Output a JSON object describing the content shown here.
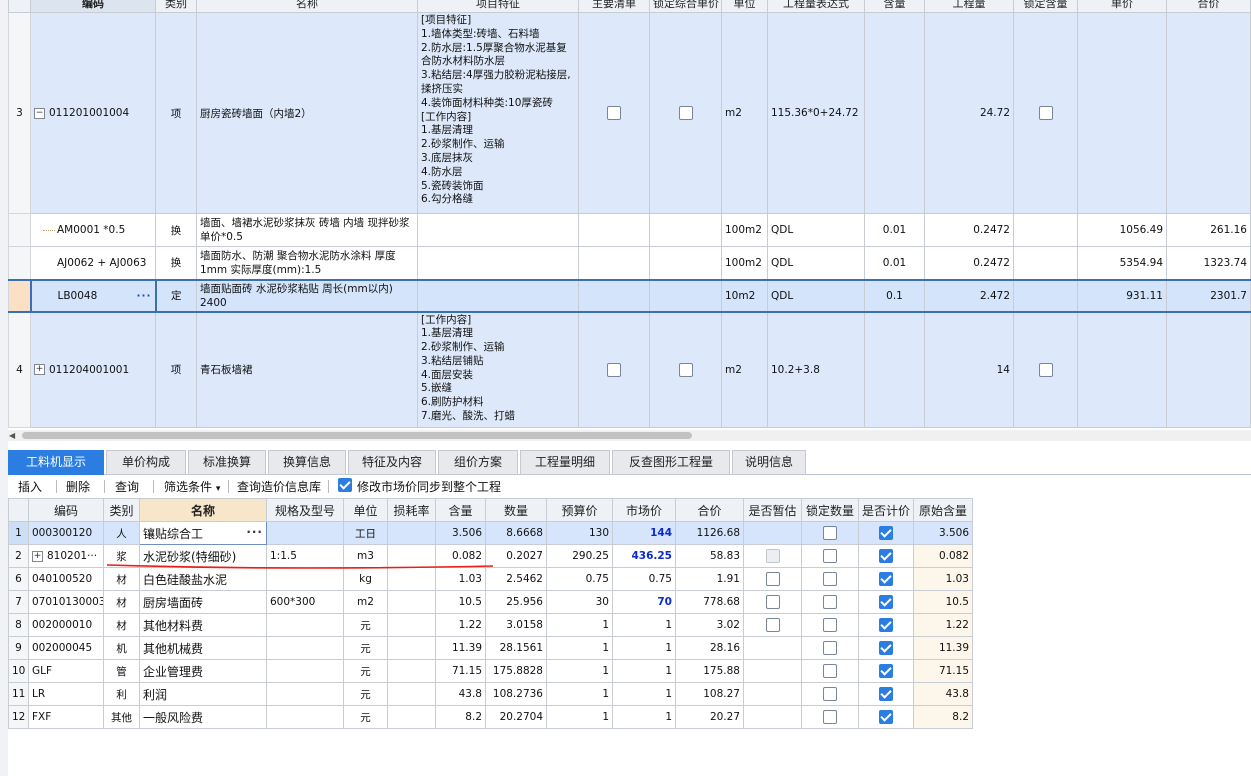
{
  "upper": {
    "headers": [
      "编码",
      "类别",
      "名称",
      "项目特征",
      "主要清单",
      "锁定综合单价",
      "单位",
      "工程量表达式",
      "含量",
      "工程量",
      "锁定含量",
      "单价",
      "合价"
    ],
    "rows": [
      {
        "rownum": "3",
        "code": "011201001004",
        "expander": "−",
        "type": "项",
        "name": "厨房瓷砖墙面（内墙2）",
        "feature": "[项目特征]\n1.墙体类型:砖墙、石料墙\n2.防水层:1.5厚聚合物水泥基复合防水材料防水层\n3.粘结层:4厚强力胶粉泥粘接层,揉挤压实\n4.装饰面材料种类:10厚瓷砖\n[工作内容]\n1.基层清理\n2.砂浆制作、运输\n3.底层抹灰\n4.防水层\n5.瓷砖装饰面\n6.勾分格缝",
        "unit": "m2",
        "expr": "115.36*0+24.72",
        "content": "",
        "qty": "24.72",
        "price": "",
        "total": ""
      },
      {
        "rownum": "",
        "code": "AM0001 *0.5",
        "type": "换",
        "name": "墙面、墙裙水泥砂浆抹灰 砖墙 内墙 现拌砂浆  单价*0.5",
        "unit": "100m2",
        "expr": "QDL",
        "content": "0.01",
        "qty": "0.2472",
        "price": "1056.49",
        "total": "261.16"
      },
      {
        "rownum": "",
        "code": "AJ0062 + AJ0063",
        "type": "换",
        "name": "墙面防水、防潮 聚合物水泥防水涂料 厚度1mm  实际厚度(mm):1.5",
        "unit": "100m2",
        "expr": "QDL",
        "content": "0.01",
        "qty": "0.2472",
        "price": "5354.94",
        "total": "1323.74"
      },
      {
        "rownum": "",
        "code": "LB0048",
        "type": "定",
        "name": "墙面贴面砖 水泥砂浆粘贴 周长(mm以内) 2400",
        "unit": "10m2",
        "expr": "QDL",
        "content": "0.1",
        "qty": "2.472",
        "price": "931.11",
        "total": "2301.7"
      },
      {
        "rownum": "4",
        "code": "011204001001",
        "expander": "+",
        "type": "项",
        "name": "青石板墙裙",
        "feature": "[工作内容]\n1.基层清理\n2.砂浆制作、运输\n3.粘结层铺贴\n4.面层安装\n5.嵌缝\n6.刷防护材料\n7.磨光、酸洗、打蜡",
        "unit": "m2",
        "expr": "10.2+3.8",
        "content": "",
        "qty": "14",
        "price": "",
        "total": ""
      }
    ],
    "ellipsis": "···"
  },
  "tabs": [
    "工料机显示",
    "单价构成",
    "标准换算",
    "换算信息",
    "特征及内容",
    "组价方案",
    "工程量明细",
    "反查图形工程量",
    "说明信息"
  ],
  "toolbar": {
    "insert": "插入",
    "delete": "删除",
    "query": "查询",
    "filter": "筛选条件",
    "filter_arrow": "▾",
    "query_price": "查询造价信息库",
    "sync_label": "修改市场价同步到整个工程"
  },
  "lower": {
    "headers": [
      "",
      "编码",
      "类别",
      "名称",
      "规格及型号",
      "单位",
      "损耗率",
      "含量",
      "数量",
      "预算价",
      "市场价",
      "合价",
      "是否暂估",
      "锁定数量",
      "是否计价",
      "原始含量"
    ],
    "rows": [
      {
        "rownum": "1",
        "code": "000300120",
        "type": "人",
        "name": "镶贴综合工",
        "spec": "",
        "unit": "工日",
        "loss": "",
        "content": "3.506",
        "qty": "8.6668",
        "budget": "130",
        "market": "144",
        "total": "1126.68",
        "est": null,
        "lock": false,
        "priced": true,
        "orig": "3.506"
      },
      {
        "rownum": "2",
        "code": "810201···",
        "type": "浆",
        "name": "水泥砂浆(特细砂)",
        "spec": "1:1.5",
        "unit": "m3",
        "loss": "",
        "content": "0.082",
        "qty": "0.2027",
        "budget": "290.25",
        "market": "436.25",
        "total": "58.83",
        "est": "disabled",
        "lock": false,
        "priced": true,
        "orig": "0.082"
      },
      {
        "rownum": "6",
        "code": "040100520",
        "type": "材",
        "name": "白色硅酸盐水泥",
        "spec": "",
        "unit": "kg",
        "loss": "",
        "content": "1.03",
        "qty": "2.5462",
        "budget": "0.75",
        "market": "0.75",
        "total": "1.91",
        "est": false,
        "lock": false,
        "priced": true,
        "orig": "1.03"
      },
      {
        "rownum": "7",
        "code": "07010130003",
        "type": "材",
        "name": "厨房墙面砖",
        "spec": "600*300",
        "unit": "m2",
        "loss": "",
        "content": "10.5",
        "qty": "25.956",
        "budget": "30",
        "market": "70",
        "total": "778.68",
        "est": false,
        "lock": false,
        "priced": true,
        "orig": "10.5"
      },
      {
        "rownum": "8",
        "code": "002000010",
        "type": "材",
        "name": "其他材料费",
        "spec": "",
        "unit": "元",
        "loss": "",
        "content": "1.22",
        "qty": "3.0158",
        "budget": "1",
        "market": "1",
        "total": "3.02",
        "est": false,
        "lock": false,
        "priced": true,
        "orig": "1.22"
      },
      {
        "rownum": "9",
        "code": "002000045",
        "type": "机",
        "name": "其他机械费",
        "spec": "",
        "unit": "元",
        "loss": "",
        "content": "11.39",
        "qty": "28.1561",
        "budget": "1",
        "market": "1",
        "total": "28.16",
        "est": null,
        "lock": false,
        "priced": true,
        "orig": "11.39"
      },
      {
        "rownum": "10",
        "code": "GLF",
        "type": "管",
        "name": "企业管理费",
        "spec": "",
        "unit": "元",
        "loss": "",
        "content": "71.15",
        "qty": "175.8828",
        "budget": "1",
        "market": "1",
        "total": "175.88",
        "est": null,
        "lock": false,
        "priced": true,
        "orig": "71.15"
      },
      {
        "rownum": "11",
        "code": "LR",
        "type": "利",
        "name": "利润",
        "spec": "",
        "unit": "元",
        "loss": "",
        "content": "43.8",
        "qty": "108.2736",
        "budget": "1",
        "market": "1",
        "total": "108.27",
        "est": null,
        "lock": false,
        "priced": true,
        "orig": "43.8"
      },
      {
        "rownum": "12",
        "code": "FXF",
        "type": "其他",
        "name": "一般风险费",
        "spec": "",
        "unit": "元",
        "loss": "",
        "content": "8.2",
        "qty": "20.2704",
        "budget": "1",
        "market": "1",
        "total": "20.27",
        "est": null,
        "lock": false,
        "priced": true,
        "orig": "8.2"
      }
    ],
    "market_highlight_rows": [
      0,
      1,
      3
    ],
    "ellipsis": "···"
  },
  "colors": {
    "accent": "#2b7de1",
    "selected_row": "#d6e5fb",
    "item_row": "#dde9fa",
    "annotation": "#e8201c"
  }
}
